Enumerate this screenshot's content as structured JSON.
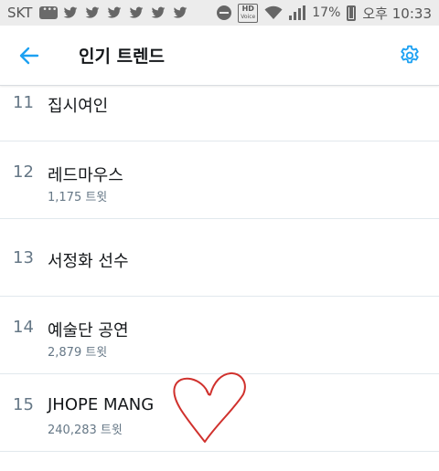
{
  "status_bar": {
    "carrier": "SKT",
    "battery_percent": "17%",
    "ampm": "오후",
    "time": "10:33",
    "hd_label": "HD",
    "voice_label": "Voice"
  },
  "header": {
    "title": "인기 트렌드"
  },
  "trends": [
    {
      "rank": "11",
      "name": "집시여인",
      "count": ""
    },
    {
      "rank": "12",
      "name": "레드마우스",
      "count": "1,175 트윗"
    },
    {
      "rank": "13",
      "name": "서정화 선수",
      "count": ""
    },
    {
      "rank": "14",
      "name": "예술단 공연",
      "count": "2,879 트윗"
    },
    {
      "rank": "15",
      "name": "JHOPE MANG",
      "count": "240,283 트윗"
    }
  ],
  "colors": {
    "accent": "#1da1f2",
    "text_primary": "#14171a",
    "text_secondary": "#657786",
    "divider": "#e1e8ed",
    "heart": "#d0312d"
  }
}
